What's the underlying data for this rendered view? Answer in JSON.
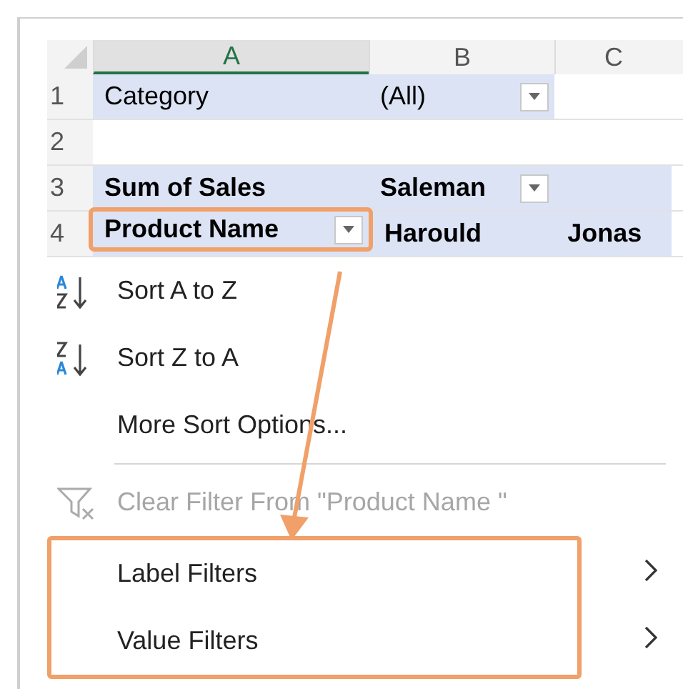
{
  "sheet": {
    "columns": [
      {
        "label": "A",
        "selected": true
      },
      {
        "label": "B",
        "selected": false
      },
      {
        "label": "C",
        "selected": false
      }
    ],
    "rows": [
      {
        "number": "1",
        "kind": "page_field",
        "cells": [
          {
            "text": "Category",
            "dropdown": false,
            "highlighted": false
          },
          {
            "text": "(All)",
            "dropdown": true,
            "highlighted": false
          }
        ]
      },
      {
        "number": "2",
        "kind": "blank",
        "cells": []
      },
      {
        "number": "3",
        "kind": "pivot_header",
        "cells": [
          {
            "text": "Sum of Sales",
            "dropdown": false,
            "highlighted": false
          },
          {
            "text": "Saleman",
            "dropdown": true,
            "highlighted": false
          }
        ]
      },
      {
        "number": "4",
        "kind": "pivot_header",
        "cells": [
          {
            "text": "Product Name",
            "dropdown": true,
            "highlighted": true
          },
          {
            "text": "Harould",
            "dropdown": false,
            "highlighted": false
          },
          {
            "text": "Jonas",
            "dropdown": false,
            "highlighted": false
          }
        ]
      }
    ]
  },
  "menu": {
    "items": [
      {
        "kind": "sort_asc",
        "label": "Sort A to Z",
        "disabled": false,
        "submenu": false,
        "highlighted": false
      },
      {
        "kind": "sort_desc",
        "label": "Sort Z to A",
        "disabled": false,
        "submenu": false,
        "highlighted": false
      },
      {
        "kind": "plain",
        "label": "More Sort Options...",
        "disabled": false,
        "submenu": false,
        "highlighted": false
      },
      {
        "kind": "separator"
      },
      {
        "kind": "clear_filter",
        "label": "Clear Filter From \"Product Name \"",
        "disabled": true,
        "submenu": false,
        "highlighted": false
      },
      {
        "kind": "plain",
        "label": "Label Filters",
        "disabled": false,
        "submenu": true,
        "highlighted": true
      },
      {
        "kind": "plain",
        "label": "Value Filters",
        "disabled": false,
        "submenu": true,
        "highlighted": true
      }
    ]
  }
}
